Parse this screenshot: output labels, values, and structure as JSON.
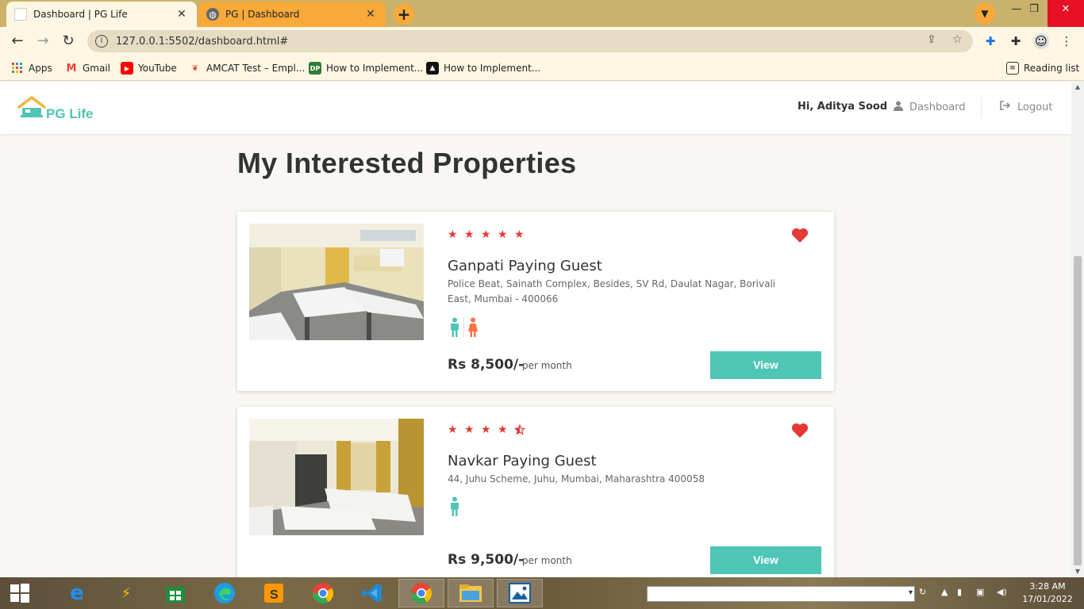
{
  "browser": {
    "tabs": [
      {
        "title": "Dashboard | PG Life",
        "active": true
      },
      {
        "title": "PG | Dashboard",
        "active": false
      }
    ],
    "new_tab": "+",
    "url": "127.0.0.1:5502/dashboard.html#",
    "bookmarks": [
      {
        "label": "Apps",
        "icon": "apps-grid-icon"
      },
      {
        "label": "Gmail",
        "icon": "gmail-icon"
      },
      {
        "label": "YouTube",
        "icon": "youtube-icon"
      },
      {
        "label": "AMCAT Test – Empl...",
        "icon": "amcat-icon"
      },
      {
        "label": "How to Implement...",
        "icon": "dp-icon"
      },
      {
        "label": "How to Implement...",
        "icon": "freecodecamp-icon"
      }
    ],
    "reading_list": "Reading list"
  },
  "navbar": {
    "logo_text": "PG Life",
    "greeting": "Hi, Aditya Sood",
    "dashboard_label": "Dashboard",
    "logout_label": "Logout"
  },
  "page": {
    "title": "My Interested Properties"
  },
  "properties": [
    {
      "name": "Ganpati Paying Guest",
      "address": "Police Beat, Sainath Complex, Besides, SV Rd, Daulat Nagar, Borivali East, Mumbai - 400066",
      "rating": 5,
      "price": "Rs 8,500/-",
      "per": "per month",
      "gender": [
        "male",
        "female"
      ],
      "interested": true,
      "view_label": "View"
    },
    {
      "name": "Navkar Paying Guest",
      "address": "44, Juhu Scheme, Juhu, Mumbai, Maharashtra 400058",
      "rating": 4.5,
      "price": "Rs 9,500/-",
      "per": "per month",
      "gender": [
        "male"
      ],
      "interested": true,
      "view_label": "View"
    }
  ],
  "taskbar": {
    "time": "3:28 AM",
    "date": "17/01/2022"
  },
  "colors": {
    "accent": "#4fc5b6",
    "star": "#e53935",
    "heart": "#e53935",
    "female": "#ff7043",
    "tab_active_bg": "#fdf6e3",
    "tab_inactive_bg": "#f7a93a"
  }
}
